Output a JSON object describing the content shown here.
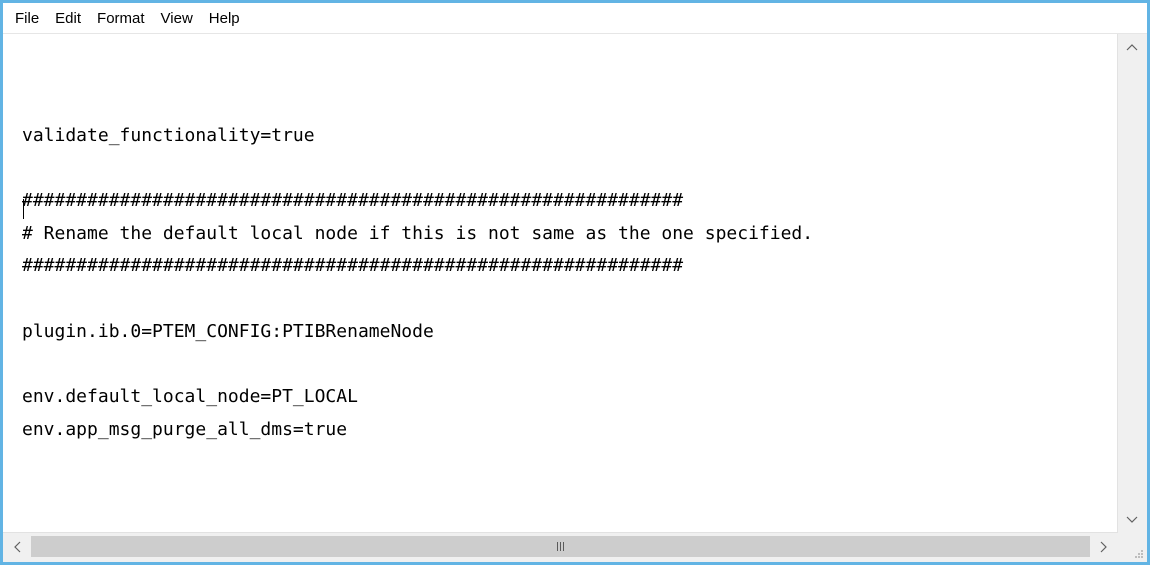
{
  "menu": [
    "File",
    "Edit",
    "Format",
    "View",
    "Help"
  ],
  "editor": {
    "lines": [
      "",
      "validate_functionality=true",
      "",
      "#############################################################",
      "# Rename the default local node if this is not same as the one specified.",
      "#############################################################",
      "",
      "plugin.ib.0=PTEM_CONFIG:PTIBRenameNode",
      "",
      "env.default_local_node=PT_LOCAL",
      "env.app_msg_purge_all_dms=true"
    ]
  },
  "icons": {
    "scroll_up": "chevron-up-icon",
    "scroll_down": "chevron-down-icon",
    "scroll_left": "chevron-left-icon",
    "scroll_right": "chevron-right-icon",
    "size_grip": "resize-grip-icon"
  },
  "colors": {
    "window_border": "#62b4e4",
    "scrollbar_bg": "#f0f0f0",
    "scroll_thumb": "#cdcdcd"
  }
}
